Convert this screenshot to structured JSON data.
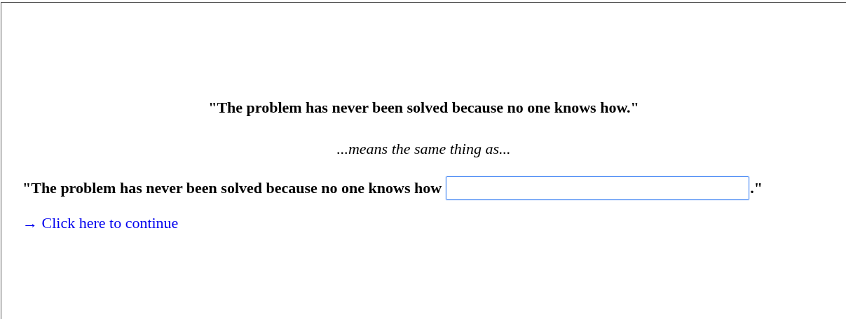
{
  "quote": "\"The problem has never been solved because no one knows how.\"",
  "connector": "...means the same thing as...",
  "prompt": {
    "before": "\"The problem has never been solved because no one knows how",
    "after": ".\""
  },
  "answer_field": {
    "focused": true
  },
  "continue_link": "→ Click here to continue"
}
